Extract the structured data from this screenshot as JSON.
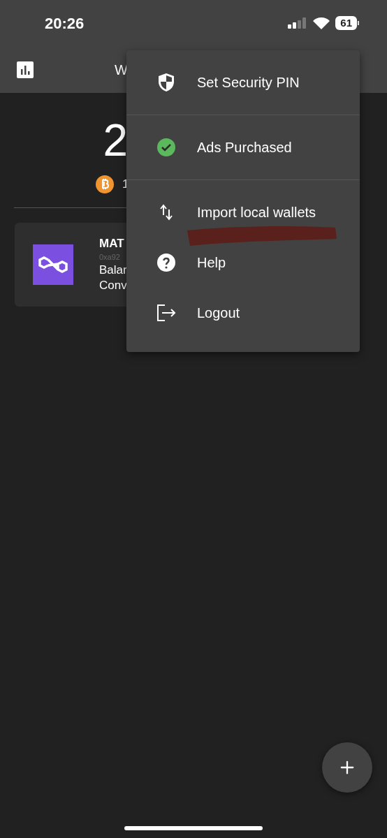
{
  "status_bar": {
    "time": "20:26",
    "battery": "61"
  },
  "app_bar": {
    "title": "W"
  },
  "balance": {
    "amount": "2",
    "btc": "1"
  },
  "wallet_card": {
    "name": "MAT",
    "address": "0xa92",
    "line_1": "Balar",
    "line_2": "Conv"
  },
  "menu": {
    "sections": [
      [
        {
          "label": "Set Security PIN"
        }
      ],
      [
        {
          "label": "Ads Purchased"
        }
      ],
      [
        {
          "label": "Import local wallets"
        },
        {
          "label": "Help"
        },
        {
          "label": "Logout"
        }
      ]
    ]
  }
}
